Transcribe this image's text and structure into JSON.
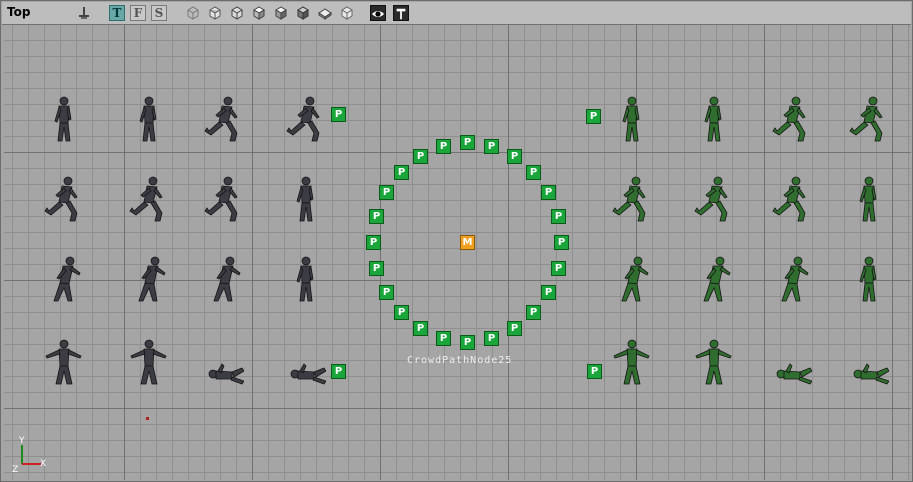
{
  "viewport": {
    "title": "Top",
    "node_label": "CrowdPathNode25",
    "path_node_text": "P",
    "master_node_text": "M",
    "axis": {
      "x": "X",
      "y": "Y",
      "z": "Z"
    }
  },
  "toolbar": {
    "letters": [
      "T",
      "F",
      "S"
    ],
    "active_letter": "T"
  },
  "icons": {
    "toolbar_buttons": [
      "anchor-icon",
      "wireframe-cube-icon",
      "zone-cube-icon",
      "texture-cube-icon",
      "solid-cube-icon",
      "dynamic-light-cube-icon",
      "lit-cube-icon",
      "material-cube-icon",
      "eye-icon",
      "pin-icon"
    ]
  },
  "colors": {
    "path_node": "#1aa63a",
    "master_node": "#f0a020",
    "dark_soldier": "#3c3c44",
    "green_soldier": "#2f6e2f"
  }
}
